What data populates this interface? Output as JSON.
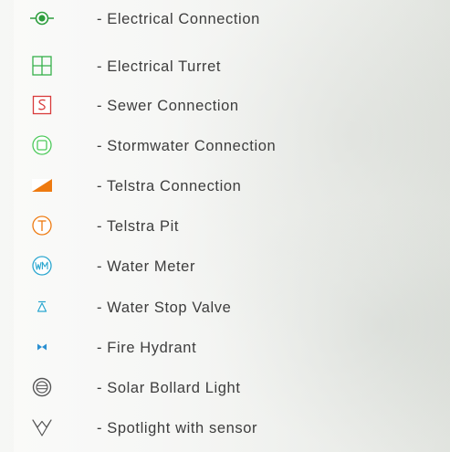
{
  "legend": {
    "items": [
      {
        "label": "- Electrical Connection",
        "icon": "electrical-connection-icon",
        "color": "#2e9e3e"
      },
      {
        "label": "- Electrical Turret",
        "icon": "electrical-turret-icon",
        "color": "#35b04a"
      },
      {
        "label": "- Sewer Connection",
        "icon": "sewer-connection-icon",
        "color": "#d83a3a"
      },
      {
        "label": "- Stormwater Connection",
        "icon": "stormwater-connection-icon",
        "color": "#4cc95a"
      },
      {
        "label": "- Telstra Connection",
        "icon": "telstra-connection-icon",
        "color": "#ee7a10"
      },
      {
        "label": "- Telstra Pit",
        "icon": "telstra-pit-icon",
        "color": "#ee7a10"
      },
      {
        "label": "- Water Meter",
        "icon": "water-meter-icon",
        "color": "#2aa6cf"
      },
      {
        "label": "- Water Stop Valve",
        "icon": "water-stop-valve-icon",
        "color": "#2aa6cf"
      },
      {
        "label": "- Fire Hydrant",
        "icon": "fire-hydrant-icon",
        "color": "#2a8fd1"
      },
      {
        "label": "- Solar Bollard Light",
        "icon": "solar-bollard-light-icon",
        "color": "#555555"
      },
      {
        "label": "- Spotlight with sensor",
        "icon": "spotlight-sensor-icon",
        "color": "#555555"
      }
    ]
  }
}
